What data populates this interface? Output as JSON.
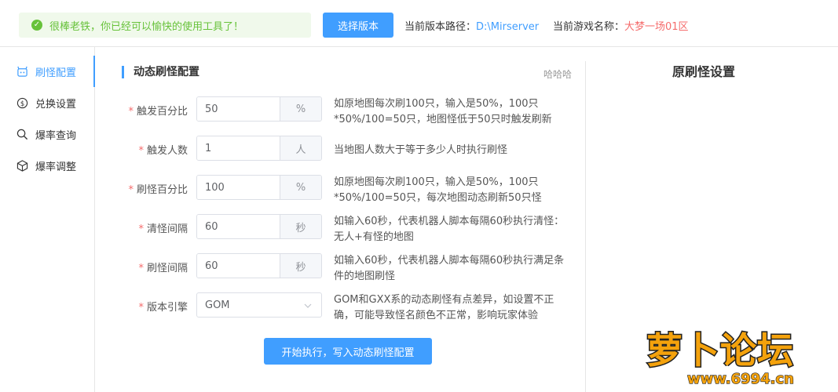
{
  "topbar": {
    "alert_text": "很棒老铁，你已经可以愉快的使用工具了！",
    "select_version_label": "选择版本",
    "path_label": "当前版本路径：",
    "path_value": "D:\\Mirserver",
    "game_label": "当前游戏名称：",
    "game_value": "大梦一场01区"
  },
  "sidebar": {
    "items": [
      {
        "label": "刷怪配置",
        "icon": "monster-icon",
        "active": true
      },
      {
        "label": "兑换设置",
        "icon": "dollar-icon",
        "active": false
      },
      {
        "label": "爆率查询",
        "icon": "search-icon",
        "active": false
      },
      {
        "label": "爆率调整",
        "icon": "cube-icon",
        "active": false
      }
    ]
  },
  "panel": {
    "title": "动态刷怪配置",
    "extra": "哈哈哈",
    "rows": [
      {
        "label": "触发百分比",
        "value": "50",
        "suffix": "%",
        "desc": "如原地图每次刷100只，输入是50%，100只*50%/100=50只，地图怪低于50只时触发刷新"
      },
      {
        "label": "触发人数",
        "value": "1",
        "suffix": "人",
        "desc": "当地图人数大于等于多少人时执行刷怪"
      },
      {
        "label": "刷怪百分比",
        "value": "100",
        "suffix": "%",
        "desc": "如原地图每次刷100只，输入是50%，100只*50%/100=50只，每次地图动态刷新50只怪"
      },
      {
        "label": "清怪间隔",
        "value": "60",
        "suffix": "秒",
        "desc": "如输入60秒，代表机器人脚本每隔60秒执行清怪：无人+有怪的地图"
      },
      {
        "label": "刷怪间隔",
        "value": "60",
        "suffix": "秒",
        "desc": "如输入60秒，代表机器人脚本每隔60秒执行满足条件的地图刷怪"
      },
      {
        "label": "版本引擎",
        "value": "GOM",
        "desc": "GOM和GXX系的动态刷怪有点差异，如设置不正确，可能导致怪名颜色不正常，影响玩家体验"
      }
    ],
    "run_label": "开始执行，写入动态刷怪配置"
  },
  "right": {
    "title": "原刷怪设置"
  },
  "watermark": {
    "text": "萝卜论坛",
    "url": "www.6994.cn"
  },
  "colors": {
    "accent": "#409eff",
    "success": "#67c23a",
    "danger": "#f56c6c"
  }
}
